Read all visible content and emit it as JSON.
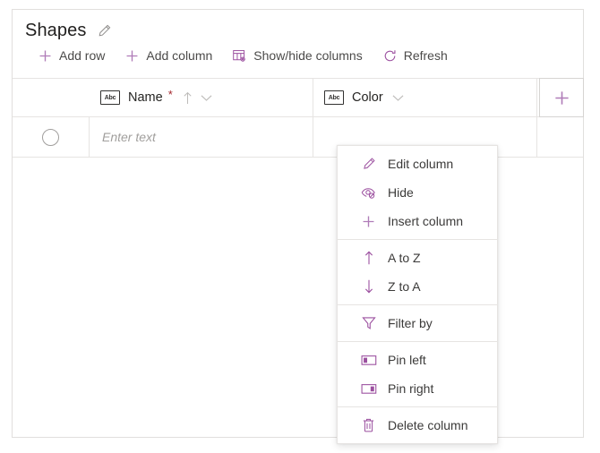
{
  "page": {
    "title": "Shapes",
    "title_edit_icon": "pencil-icon"
  },
  "toolbar": {
    "items": [
      {
        "label": "Add row",
        "icon": "plus-icon"
      },
      {
        "label": "Add column",
        "icon": "plus-icon"
      },
      {
        "label": "Show/hide columns",
        "icon": "table-settings-icon"
      },
      {
        "label": "Refresh",
        "icon": "refresh-icon"
      }
    ]
  },
  "grid": {
    "add_column_icon": "plus-icon",
    "columns": [
      {
        "name": "Name",
        "type_icon": "abc-icon",
        "type_icon_label": "Abc",
        "required": true,
        "required_marker": "*",
        "sorted": true,
        "sort_icon": "arrow-up-icon",
        "menu_icon": "chevron-down-icon"
      },
      {
        "name": "Color",
        "type_icon": "abc-icon",
        "type_icon_label": "Abc",
        "required": false,
        "required_marker": "",
        "sorted": false,
        "sort_icon": "",
        "menu_icon": "chevron-down-icon"
      }
    ],
    "rows": [
      {
        "select_control": "radio-unselected",
        "name_placeholder": "Enter text",
        "color_placeholder": ""
      }
    ]
  },
  "column_menu": {
    "open_for_column": "Color",
    "groups": [
      {
        "items": [
          {
            "label": "Edit column",
            "icon": "pencil-icon"
          },
          {
            "label": "Hide",
            "icon": "eye-hide-icon"
          },
          {
            "label": "Insert column",
            "icon": "plus-icon"
          }
        ]
      },
      {
        "items": [
          {
            "label": "A to Z",
            "icon": "arrow-up-icon"
          },
          {
            "label": "Z to A",
            "icon": "arrow-down-icon"
          }
        ]
      },
      {
        "items": [
          {
            "label": "Filter by",
            "icon": "filter-icon"
          }
        ]
      },
      {
        "items": [
          {
            "label": "Pin left",
            "icon": "pin-left-icon"
          },
          {
            "label": "Pin right",
            "icon": "pin-right-icon"
          }
        ]
      },
      {
        "items": [
          {
            "label": "Delete column",
            "icon": "trash-icon"
          }
        ]
      }
    ]
  },
  "colors": {
    "accent_purple": "#a866b0",
    "menu_icon_purple": "#9b4f9f",
    "required_red": "#a4262c",
    "text_primary": "#201f1e",
    "text_secondary": "#4b4a49",
    "placeholder_gray": "#a19f9d",
    "border_gray": "#e6e4e2",
    "background": "#ffffff"
  }
}
